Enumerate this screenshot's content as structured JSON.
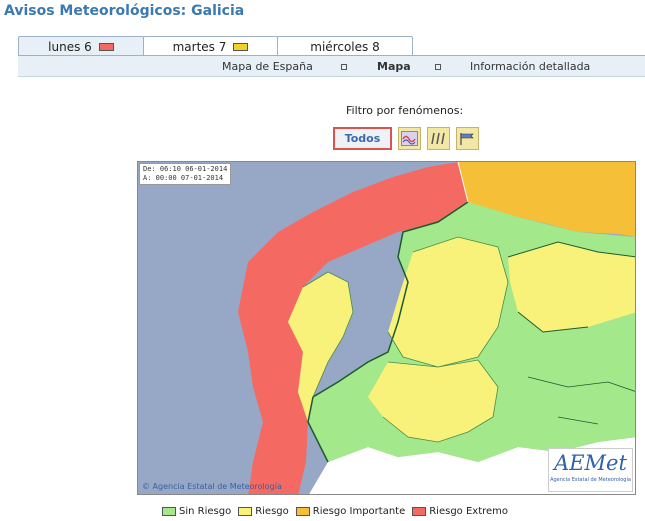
{
  "page": {
    "title": "Avisos Meteorológicos: Galicia"
  },
  "tabs": [
    {
      "label": "lunes 6",
      "level_color": "#f46a63",
      "active": true
    },
    {
      "label": "martes 7",
      "level_color": "#f2d22a",
      "active": false
    },
    {
      "label": "miércoles 8",
      "level_color": "",
      "active": false
    }
  ],
  "subnav": {
    "items": [
      "Mapa de España",
      "Mapa",
      "Información detallada"
    ],
    "current": "Mapa"
  },
  "filter": {
    "label": "Filtro por fenómenos:",
    "todos_label": "Todos",
    "icons": [
      "coastal-waves-icon",
      "rain-icon",
      "wind-icon"
    ]
  },
  "map": {
    "dates": [
      "De: 06:10 06-01-2014",
      "A:  00:00 07-01-2014"
    ],
    "credit": "Agencia Estatal de Meteorología",
    "logo_text": "AEMet",
    "logo_subtext": "Agencia Estatal de Meteorología",
    "colors": {
      "sea": "#97a8c6",
      "none": "#a3e88a",
      "yellow": "#f8f27a",
      "orange": "#f5c038",
      "red": "#f46a63",
      "land_outside": "#ffffff"
    }
  },
  "legend": [
    {
      "label": "Sin Riesgo",
      "color": "#a3e88a"
    },
    {
      "label": "Riesgo",
      "color": "#f8f27a"
    },
    {
      "label": "Riesgo Importante",
      "color": "#f5c038"
    },
    {
      "label": "Riesgo Extremo",
      "color": "#f46a63"
    }
  ]
}
